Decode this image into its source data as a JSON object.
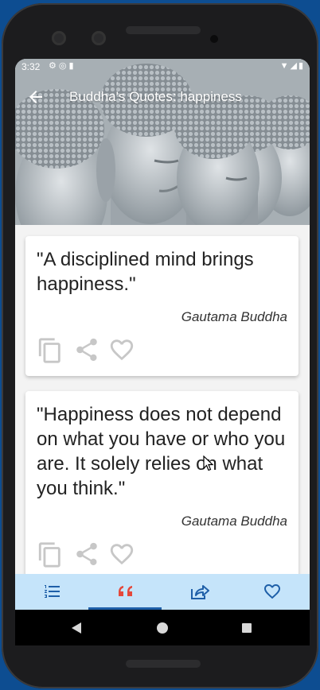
{
  "status_bar": {
    "time": "3:32"
  },
  "app_bar": {
    "title": "Buddha's Quotes: happiness"
  },
  "quotes": [
    {
      "text": "\"A disciplined mind brings happiness.\"",
      "author": "Gautama Buddha"
    },
    {
      "text": "\"Happiness does not depend on what you have or who you are. It solely relies on what you think.\"",
      "author": "Gautama Buddha"
    }
  ],
  "icons": {
    "back": "arrow-left-icon",
    "copy": "copy-icon",
    "share": "share-icon",
    "favorite": "heart-outline-icon",
    "nav": [
      "numbered-list-icon",
      "quote-icon",
      "share-arrow-icon",
      "heart-outline-icon"
    ]
  },
  "bottom_nav": {
    "active_index": 1
  },
  "colors": {
    "accent_red": "#e5483b",
    "nav_blue": "#1e5fa8",
    "nav_bg": "#c5e4fa"
  }
}
